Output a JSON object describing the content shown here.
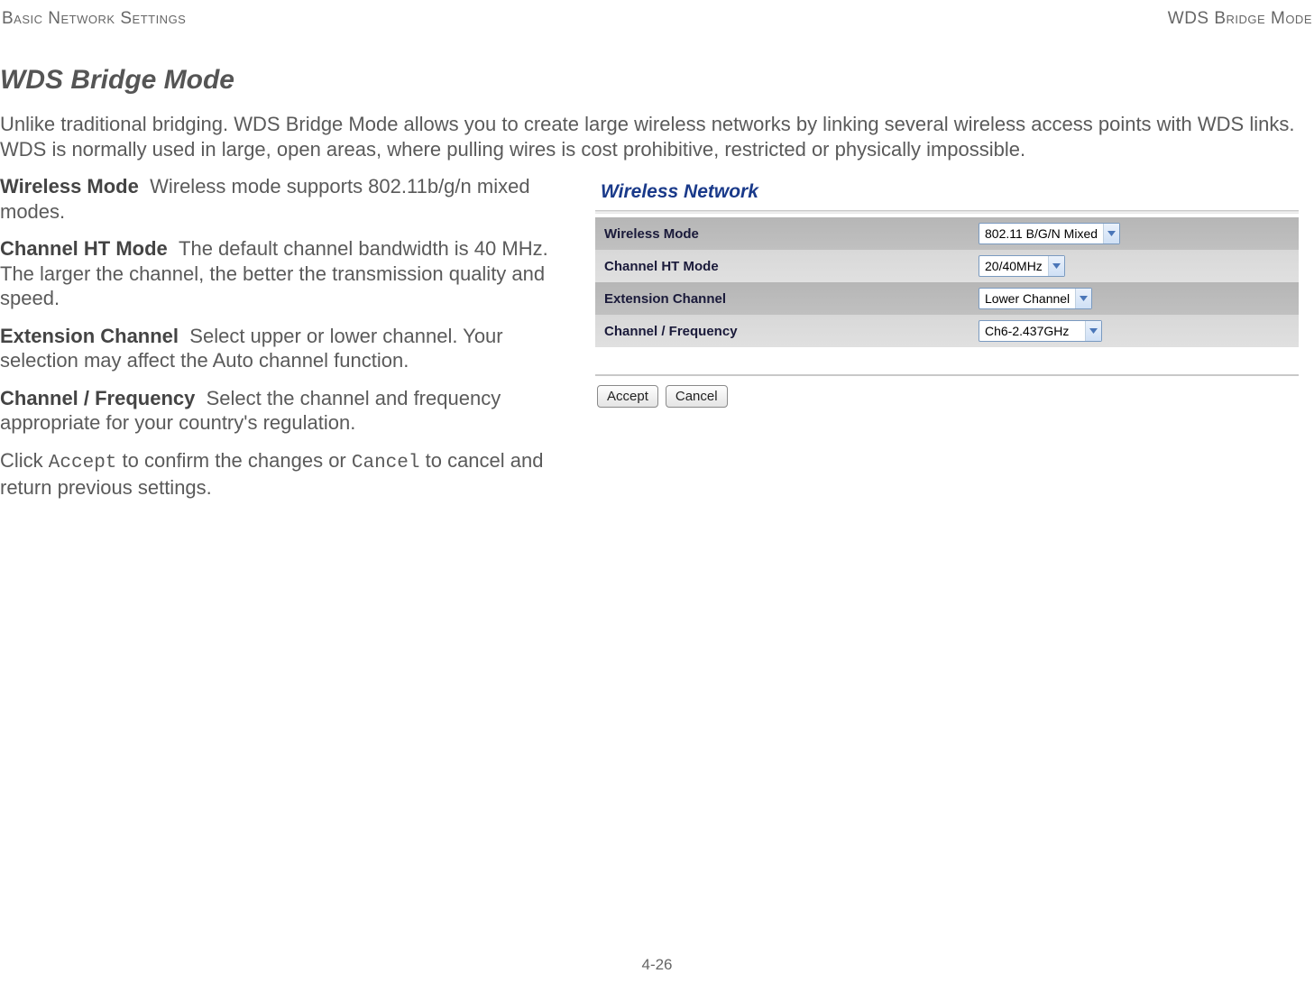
{
  "header": {
    "left": "Basic Network Settings",
    "right": "WDS Bridge Mode"
  },
  "title": "WDS Bridge Mode",
  "intro": "Unlike traditional bridging. WDS Bridge Mode allows you to create large wireless networks by linking several wireless access points with WDS links. WDS is normally used in large, open areas, where pulling wires is cost prohibitive, restricted or physically impossible.",
  "definitions": [
    {
      "term": "Wireless Mode",
      "desc": "Wireless mode supports 802.11b/g/n mixed modes."
    },
    {
      "term": "Channel HT Mode",
      "desc": "The default channel bandwidth is 40 MHz. The larger the channel, the better the transmission quality and speed."
    },
    {
      "term": "Extension Channel",
      "desc": "Select upper or lower channel. Your selection may affect the Auto channel function."
    },
    {
      "term": "Channel / Frequency",
      "desc": "Select the channel and frequency appropriate for your country's regulation."
    }
  ],
  "closing": {
    "prefix": "Click ",
    "accept": "Accept",
    "mid": " to confirm the changes or ",
    "cancel": "Cancel",
    "suffix": " to cancel and return previous settings."
  },
  "panel": {
    "title": "Wireless Network",
    "rows": [
      {
        "label": "Wireless Mode",
        "value": "802.11 B/G/N Mixed"
      },
      {
        "label": "Channel HT Mode",
        "value": "20/40MHz"
      },
      {
        "label": "Extension Channel",
        "value": "Lower Channel"
      },
      {
        "label": "Channel / Frequency",
        "value": "Ch6-2.437GHz"
      }
    ],
    "buttons": {
      "accept": "Accept",
      "cancel": "Cancel"
    }
  },
  "footer": "4-26"
}
